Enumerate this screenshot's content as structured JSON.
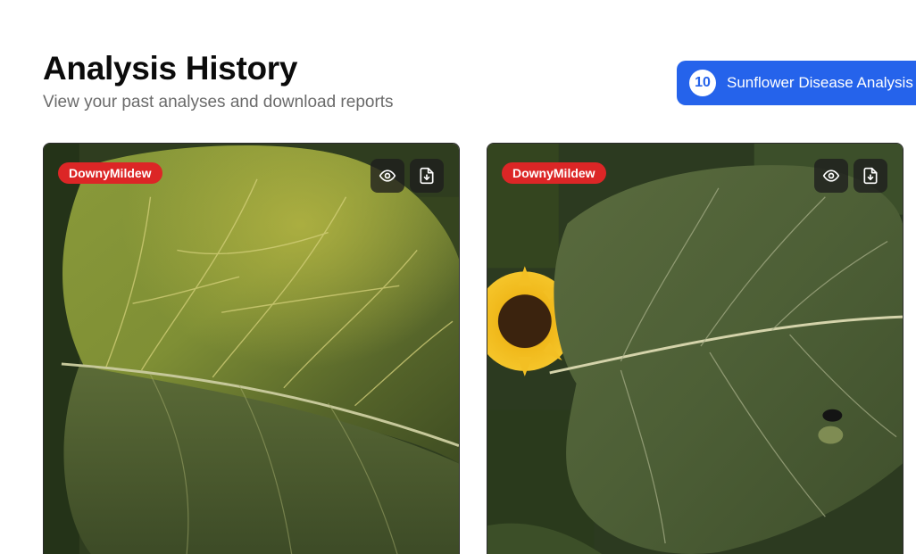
{
  "header": {
    "title": "Analysis History",
    "subtitle": "View your past analyses and download reports"
  },
  "summary": {
    "count": "10",
    "label": "Sunflower Disease Analysis"
  },
  "cards": [
    {
      "badge": "DownyMildew",
      "view_icon": "eye-icon",
      "download_icon": "file-download-icon"
    },
    {
      "badge": "DownyMildew",
      "view_icon": "eye-icon",
      "download_icon": "file-download-icon"
    }
  ],
  "colors": {
    "accent": "#2563eb",
    "badge": "#dc2626"
  }
}
